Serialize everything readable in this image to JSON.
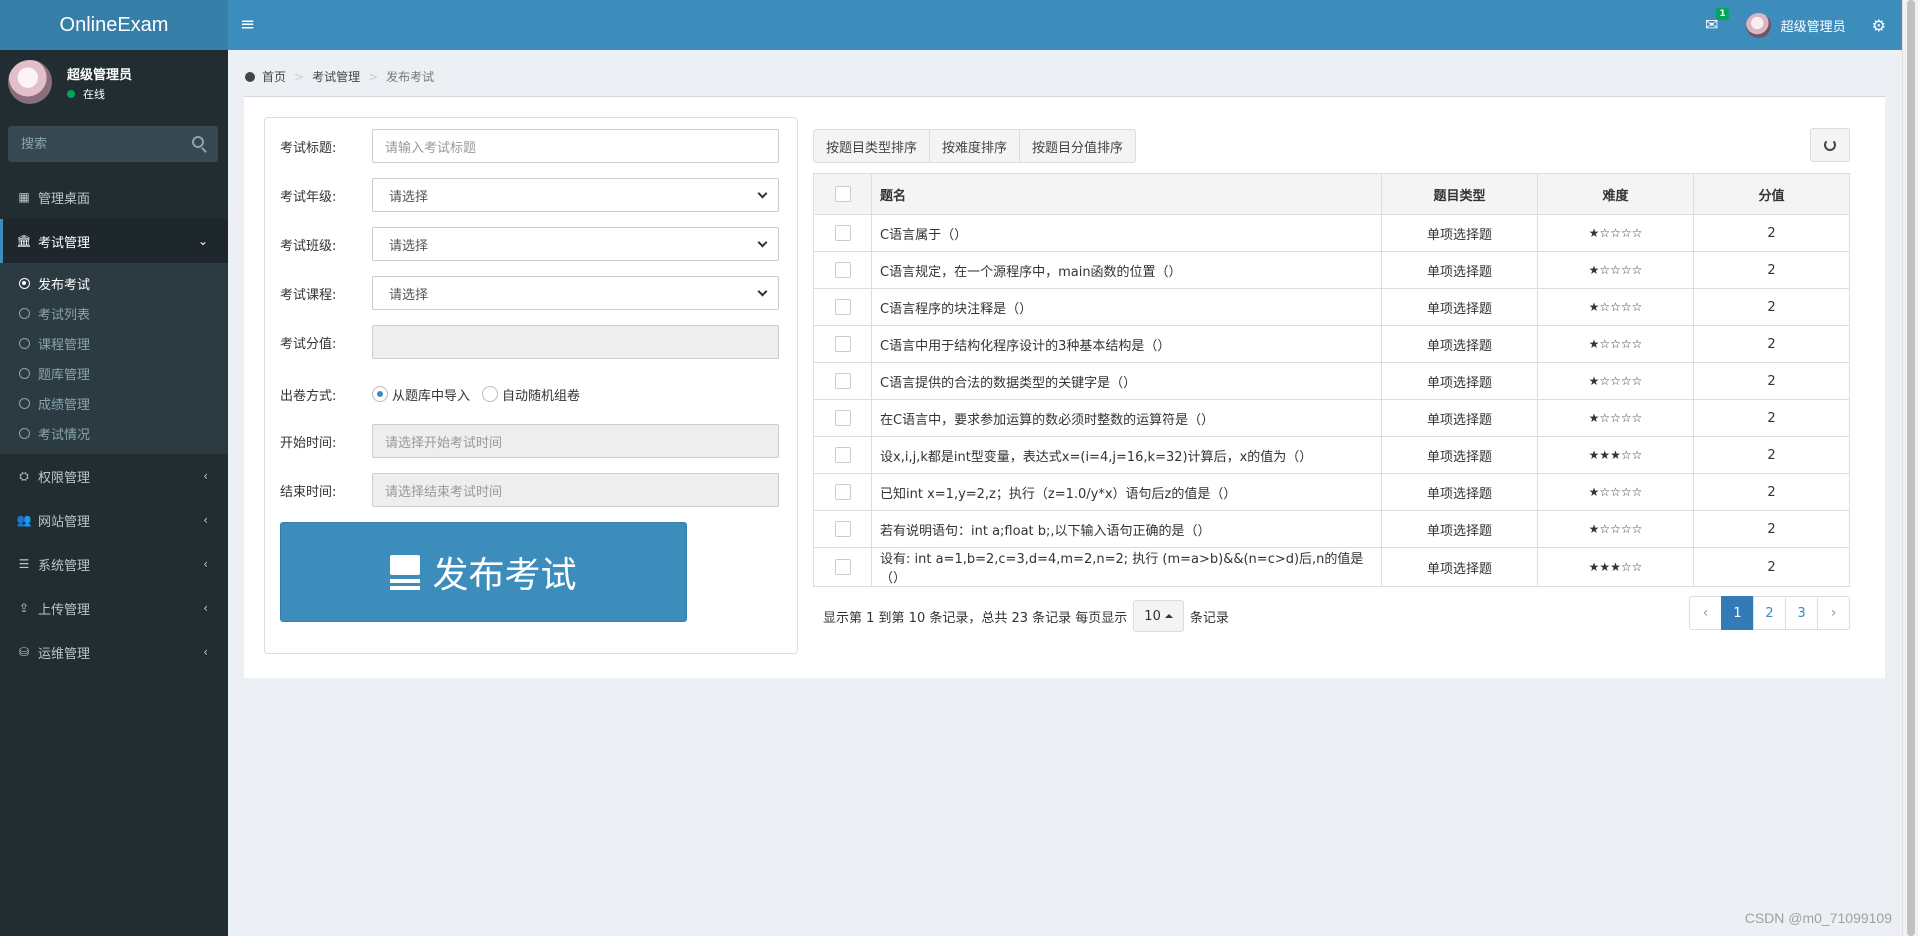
{
  "header": {
    "brand": "OnlineExam",
    "mail_badge": "1",
    "user_name": "超级管理员"
  },
  "sidebar": {
    "user_name": "超级管理员",
    "status": "在线",
    "search_placeholder": "搜索",
    "menu": [
      {
        "label": "管理桌面",
        "icon": "dashboard-icon"
      },
      {
        "label": "考试管理",
        "icon": "bank-icon",
        "active": true
      },
      {
        "label": "权限管理",
        "icon": "sitemap-icon"
      },
      {
        "label": "网站管理",
        "icon": "users-icon"
      },
      {
        "label": "系统管理",
        "icon": "list-icon"
      },
      {
        "label": "上传管理",
        "icon": "upload-icon"
      },
      {
        "label": "运维管理",
        "icon": "database-icon"
      }
    ],
    "submenu": [
      "发布考试",
      "考试列表",
      "课程管理",
      "题库管理",
      "成绩管理",
      "考试情况"
    ]
  },
  "breadcrumb": {
    "home": "首页",
    "section": "考试管理",
    "current": "发布考试"
  },
  "form": {
    "title_label": "考试标题:",
    "title_placeholder": "请输入考试标题",
    "grade_label": "考试年级:",
    "grade_value": "请选择",
    "class_label": "考试班级:",
    "class_value": "请选择",
    "course_label": "考试课程:",
    "course_value": "请选择",
    "score_label": "考试分值:",
    "mode_label": "出卷方式:",
    "mode_option_import": "从题库中导入",
    "mode_option_random": "自动随机组卷",
    "start_label": "开始时间:",
    "start_placeholder": "请选择开始考试时间",
    "end_label": "结束时间:",
    "end_placeholder": "请选择结束考试时间",
    "submit_label": "发布考试"
  },
  "toolbar": {
    "sort_by_type": "按题目类型排序",
    "sort_by_difficulty": "按难度排序",
    "sort_by_score": "按题目分值排序"
  },
  "table": {
    "headers": [
      "题名",
      "题目类型",
      "难度",
      "分值"
    ],
    "rows": [
      {
        "title": "C语言属于（）",
        "type": "单项选择题",
        "difficulty": "★☆☆☆☆",
        "score": "2"
      },
      {
        "title": "C语言规定，在一个源程序中，main函数的位置（）",
        "type": "单项选择题",
        "difficulty": "★☆☆☆☆",
        "score": "2"
      },
      {
        "title": "C语言程序的块注释是（）",
        "type": "单项选择题",
        "difficulty": "★☆☆☆☆",
        "score": "2"
      },
      {
        "title": "C语言中用于结构化程序设计的3种基本结构是（）",
        "type": "单项选择题",
        "difficulty": "★☆☆☆☆",
        "score": "2"
      },
      {
        "title": "C语言提供的合法的数据类型的关键字是（）",
        "type": "单项选择题",
        "difficulty": "★☆☆☆☆",
        "score": "2"
      },
      {
        "title": "在C语言中，要求参加运算的数必须时整数的运算符是（）",
        "type": "单项选择题",
        "difficulty": "★☆☆☆☆",
        "score": "2"
      },
      {
        "title": "设x,i,j,k都是int型变量，表达式x=(i=4,j=16,k=32)计算后，x的值为（）",
        "type": "单项选择题",
        "difficulty": "★★★☆☆",
        "score": "2"
      },
      {
        "title": "已知int x=1,y=2,z；执行（z=1.0/y*x）语句后z的值是（）",
        "type": "单项选择题",
        "difficulty": "★☆☆☆☆",
        "score": "2"
      },
      {
        "title": "若有说明语句：int a;float b;,以下输入语句正确的是（）",
        "type": "单项选择题",
        "difficulty": "★☆☆☆☆",
        "score": "2"
      },
      {
        "title": "设有: int a=1,b=2,c=3,d=4,m=2,n=2; 执行 (m=a>b)&&(n=c>d)后,n的值是（）",
        "type": "单项选择题",
        "difficulty": "★★★☆☆",
        "score": "2"
      }
    ]
  },
  "pagination": {
    "info_prefix": "显示第 1 到第 10 条记录，总共 23 条记录 每页显示",
    "page_size": "10",
    "info_suffix": "条记录",
    "prev": "‹",
    "pages": [
      "1",
      "2",
      "3"
    ],
    "next": "›",
    "current_page": 1
  },
  "watermark": "CSDN @m0_71099109",
  "colors": {
    "header": "#3c8dbc",
    "logo": "#367fa9",
    "sidebar": "#222d32",
    "primary_button": "#3c8dbc"
  }
}
